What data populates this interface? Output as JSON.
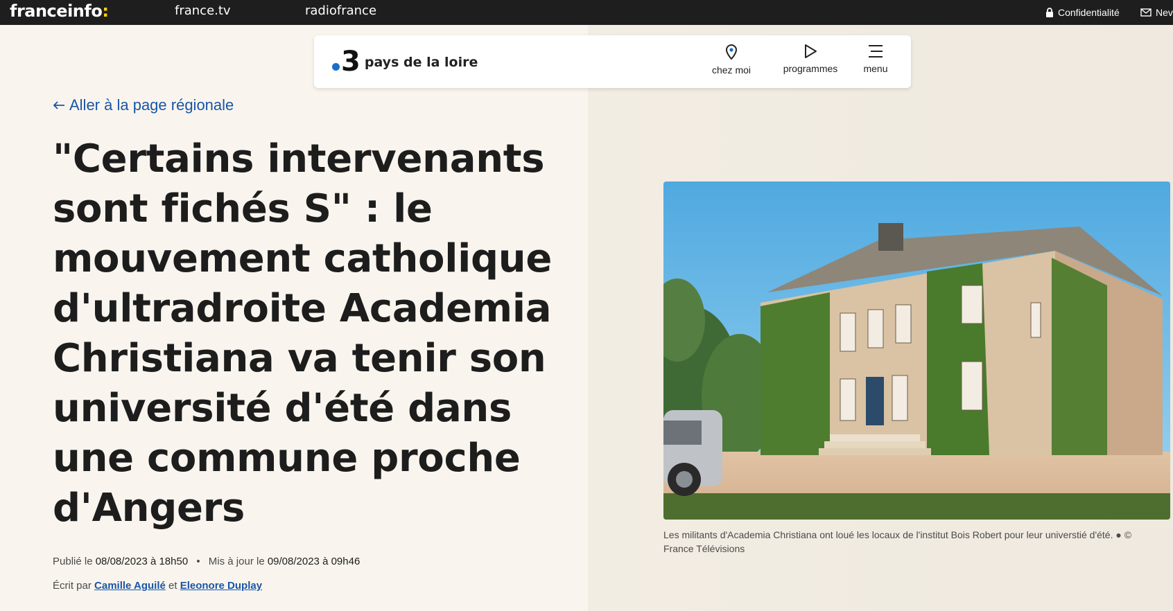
{
  "topbar": {
    "brand": "franceinfo",
    "brand_colon": ":",
    "link_francetv": "france.tv",
    "link_radiofrance": "radiofrance",
    "privacy": "Confidentialité",
    "newsletter": "Nev"
  },
  "region": {
    "logo_number": "3",
    "name": "pays de la loire",
    "nav": {
      "home_label": "chez moi",
      "programs_label": "programmes",
      "menu_label": "menu"
    }
  },
  "article": {
    "back_link": "Aller à la page régionale",
    "title": "\"Certains intervenants sont fichés S\" : le mouvement catholique d'ultradroite Academia Christiana va tenir son université d'été dans une commune proche d'Angers",
    "published_prefix": "Publié le",
    "published_date": "08/08/2023 à 18h50",
    "separator": "•",
    "updated_prefix": "Mis à jour le",
    "updated_date": "09/08/2023 à 09h46",
    "written_by": "Écrit par",
    "author_1": "Camille Aguilé",
    "and": "et",
    "author_2": "Eleonore Duplay",
    "caption": "Les militants d'Academia Christiana ont loué les locaux de l'institut Bois Robert pour leur universtié d'été. ● © France Télévisions"
  },
  "colors": {
    "accent_link": "#1a55a6",
    "brand_yellow": "#ffd200",
    "topbar_bg": "#1e1e1e"
  },
  "icons": {
    "privacy": "lock-icon",
    "newsletter": "mail-icon",
    "home": "location-pin-icon",
    "programs": "play-icon",
    "menu": "hamburger-icon",
    "back": "arrow-left-icon"
  }
}
